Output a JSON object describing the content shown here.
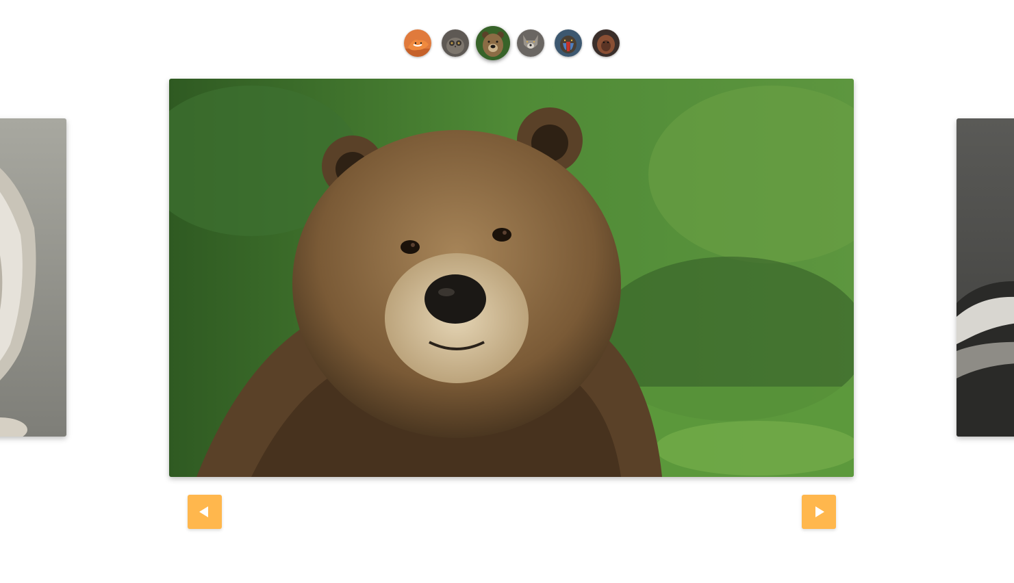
{
  "carousel": {
    "active_index": 2,
    "thumbnails": [
      {
        "subject": "fox",
        "icon": "fox-thumbnail-icon",
        "color": "#d9642a"
      },
      {
        "subject": "owl",
        "icon": "owl-thumbnail-icon",
        "color": "#5a5550"
      },
      {
        "subject": "bear",
        "icon": "bear-thumbnail-icon",
        "color": "#6b5436"
      },
      {
        "subject": "wolf",
        "icon": "wolf-thumbnail-icon",
        "color": "#6e6a66"
      },
      {
        "subject": "mandrill",
        "icon": "mandrill-thumbnail-icon",
        "color": "#3f5a73"
      },
      {
        "subject": "orangutan",
        "icon": "orangutan-thumbnail-icon",
        "color": "#7a4a36"
      }
    ],
    "main_slide": {
      "subject": "bear",
      "background": "#3e6b2c"
    },
    "prev_slide": {
      "subject": "lion",
      "background": "#8a8a84"
    },
    "next_slide": {
      "subject": "badger",
      "background": "#4a4a48"
    }
  },
  "controls": {
    "prev_icon": "arrow-left-icon",
    "next_icon": "arrow-right-icon",
    "accent_color": "#ffb74d"
  }
}
